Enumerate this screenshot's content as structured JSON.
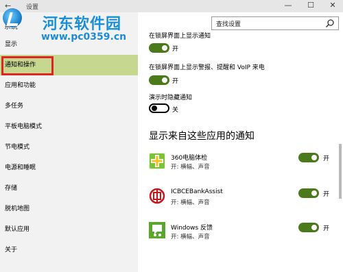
{
  "window": {
    "title": "设置",
    "back_glyph": "←",
    "minimize_glyph": "—",
    "maximize_glyph": "☐",
    "close_glyph": "✕"
  },
  "watermark": {
    "text": "河东软件园",
    "url": "www.pc0359.cn"
  },
  "sidebar": {
    "partial_top": "系统",
    "items": [
      {
        "label": "显示"
      },
      {
        "label": "通知和操作"
      },
      {
        "label": "应用和功能"
      },
      {
        "label": "多任务"
      },
      {
        "label": "平板电脑模式"
      },
      {
        "label": "节电模式"
      },
      {
        "label": "电源和睡眠"
      },
      {
        "label": "存储"
      },
      {
        "label": "脱机地图"
      },
      {
        "label": "默认应用"
      },
      {
        "label": "关于"
      }
    ]
  },
  "search": {
    "placeholder": "查找设置"
  },
  "main": {
    "settings": [
      {
        "text": "在锁屏界面上显示通知",
        "state": "开"
      },
      {
        "text": "在锁屏界面上显示警报、提醒和 VoIP 来电",
        "state": "开"
      },
      {
        "text": "演示时隐藏通知",
        "state": "关"
      }
    ],
    "section_heading": "显示来自这些应用的通知",
    "apps": [
      {
        "name": "360电脑体检",
        "detail": "开: 横幅、声音",
        "state": "开"
      },
      {
        "name": "ICBCEBankAssist",
        "detail": "开: 横幅、声音",
        "state": "开"
      },
      {
        "name": "Windows 反馈",
        "detail": "开: 横幅、声音",
        "state": "开"
      }
    ]
  },
  "colors": {
    "accent_toggle": "#4a7a1a",
    "selected_nav": "#c6d88f",
    "highlight_border": "#e02424",
    "watermark_blue": "#1b8fd8"
  }
}
